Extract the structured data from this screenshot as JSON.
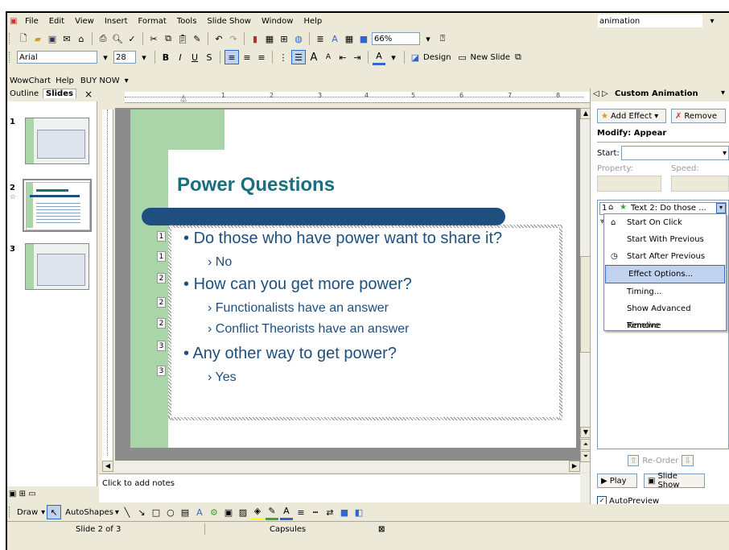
{
  "menu": [
    "File",
    "Edit",
    "View",
    "Insert",
    "Format",
    "Tools",
    "Slide Show",
    "Window",
    "Help"
  ],
  "help_search": "animation",
  "zoom": "66%",
  "font_name": "Arial",
  "font_size": "28",
  "design_label": "Design",
  "new_slide_label": "New Slide",
  "addin_bar": {
    "wowchart": "WowChart",
    "help": "Help",
    "buynow": "BUY NOW"
  },
  "tabs": {
    "outline": "Outline",
    "slides": "Slides",
    "close": "×"
  },
  "thumb_numbers": [
    "1",
    "2",
    "3"
  ],
  "slide": {
    "title": "Power Questions",
    "bullets": [
      {
        "level": 1,
        "tag": "1",
        "text": "Do those who have power want to share it?"
      },
      {
        "level": 2,
        "tag": "1",
        "text": "No"
      },
      {
        "level": 1,
        "tag": "2",
        "text": "How can you get more power?"
      },
      {
        "level": 2,
        "tag": "2",
        "text": "Functionalists have an answer"
      },
      {
        "level": 2,
        "tag": "2",
        "text": "Conflict Theorists have an answer"
      },
      {
        "level": 1,
        "tag": "3",
        "text": "Any other way to get power?"
      },
      {
        "level": 2,
        "tag": "3",
        "text": "Yes"
      }
    ]
  },
  "ruler_numbers": [
    "1",
    "2",
    "3",
    "4",
    "5",
    "6",
    "7",
    "8"
  ],
  "notes_placeholder": "Click to add notes",
  "drawing": {
    "draw": "Draw",
    "autoshapes": "AutoShapes"
  },
  "status": {
    "slide": "Slide 2 of 3",
    "design": "Capsules"
  },
  "task_pane": {
    "title": "Custom Animation",
    "add_effect": "Add Effect",
    "remove": "Remove",
    "modify": "Modify: Appear",
    "start_label": "Start:",
    "property_label": "Property:",
    "speed_label": "Speed:",
    "item_num": "1",
    "item_text": "Text 2: Do those ...",
    "reorder": "Re-Order",
    "play": "Play",
    "slideshow": "Slide Show",
    "autopreview": "AutoPreview"
  },
  "context_menu": [
    "Start On Click",
    "Start With Previous",
    "Start After Previous",
    "Effect Options...",
    "Timing...",
    "Show Advanced Timeline",
    "Remove"
  ],
  "colors": {
    "accent": "#1e4f7f",
    "title": "#1a6f7f",
    "slide_green": "#aad5a8",
    "highlight": "#c1d2ee"
  }
}
